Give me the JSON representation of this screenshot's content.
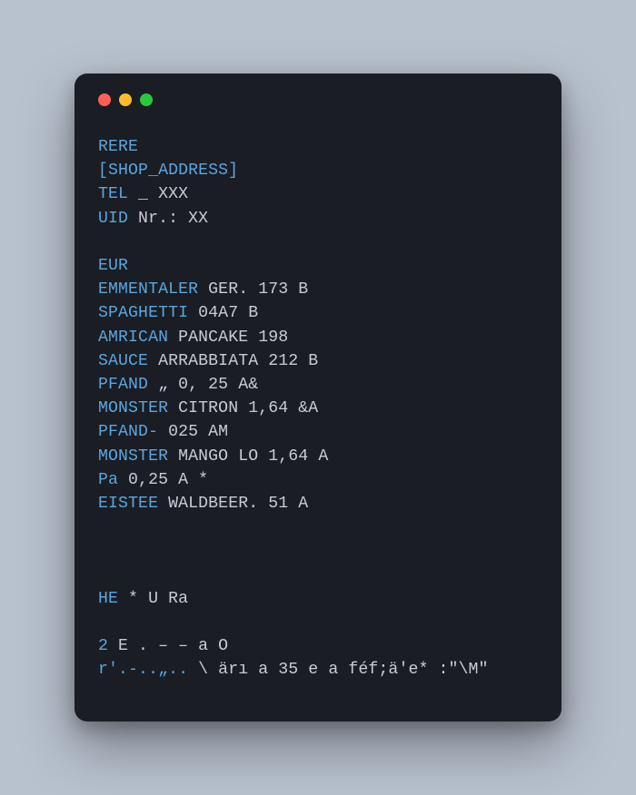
{
  "lines": [
    {
      "key": "RERE",
      "rest": ""
    },
    {
      "key": "[SHOP_ADDRESS]",
      "rest": ""
    },
    {
      "key": "TEL",
      "rest": " _ XXX"
    },
    {
      "key": "UID",
      "rest": " Nr.: XX"
    },
    {
      "key": "",
      "rest": ""
    },
    {
      "key": "EUR",
      "rest": ""
    },
    {
      "key": "EMMENTALER",
      "rest": " GER. 173 B"
    },
    {
      "key": "SPAGHETTI",
      "rest": " 04A7 B"
    },
    {
      "key": "AMRICAN",
      "rest": " PANCAKE 198"
    },
    {
      "key": "SAUCE",
      "rest": " ARRABBIATA 212 B"
    },
    {
      "key": "PFAND",
      "rest": " „ 0, 25 A&"
    },
    {
      "key": "MONSTER",
      "rest": " CITRON 1,64 &A"
    },
    {
      "key": "PFAND-",
      "rest": " 025 AM"
    },
    {
      "key": "MONSTER",
      "rest": " MANGO LO 1,64 A"
    },
    {
      "key": "Pa",
      "rest": " 0,25 A *"
    },
    {
      "key": "EISTEE",
      "rest": " WALDBEER. 51 A"
    },
    {
      "key": "",
      "rest": ""
    },
    {
      "key": "",
      "rest": ""
    },
    {
      "key": "",
      "rest": ""
    },
    {
      "key": "HE",
      "rest": " * U Ra"
    },
    {
      "key": "",
      "rest": ""
    },
    {
      "key": "2",
      "rest": " E . – – a O"
    },
    {
      "key": "r'.-..„..",
      "rest": " \\ ärı a 35 e a féf;ä'e* :\"\\M\""
    }
  ]
}
